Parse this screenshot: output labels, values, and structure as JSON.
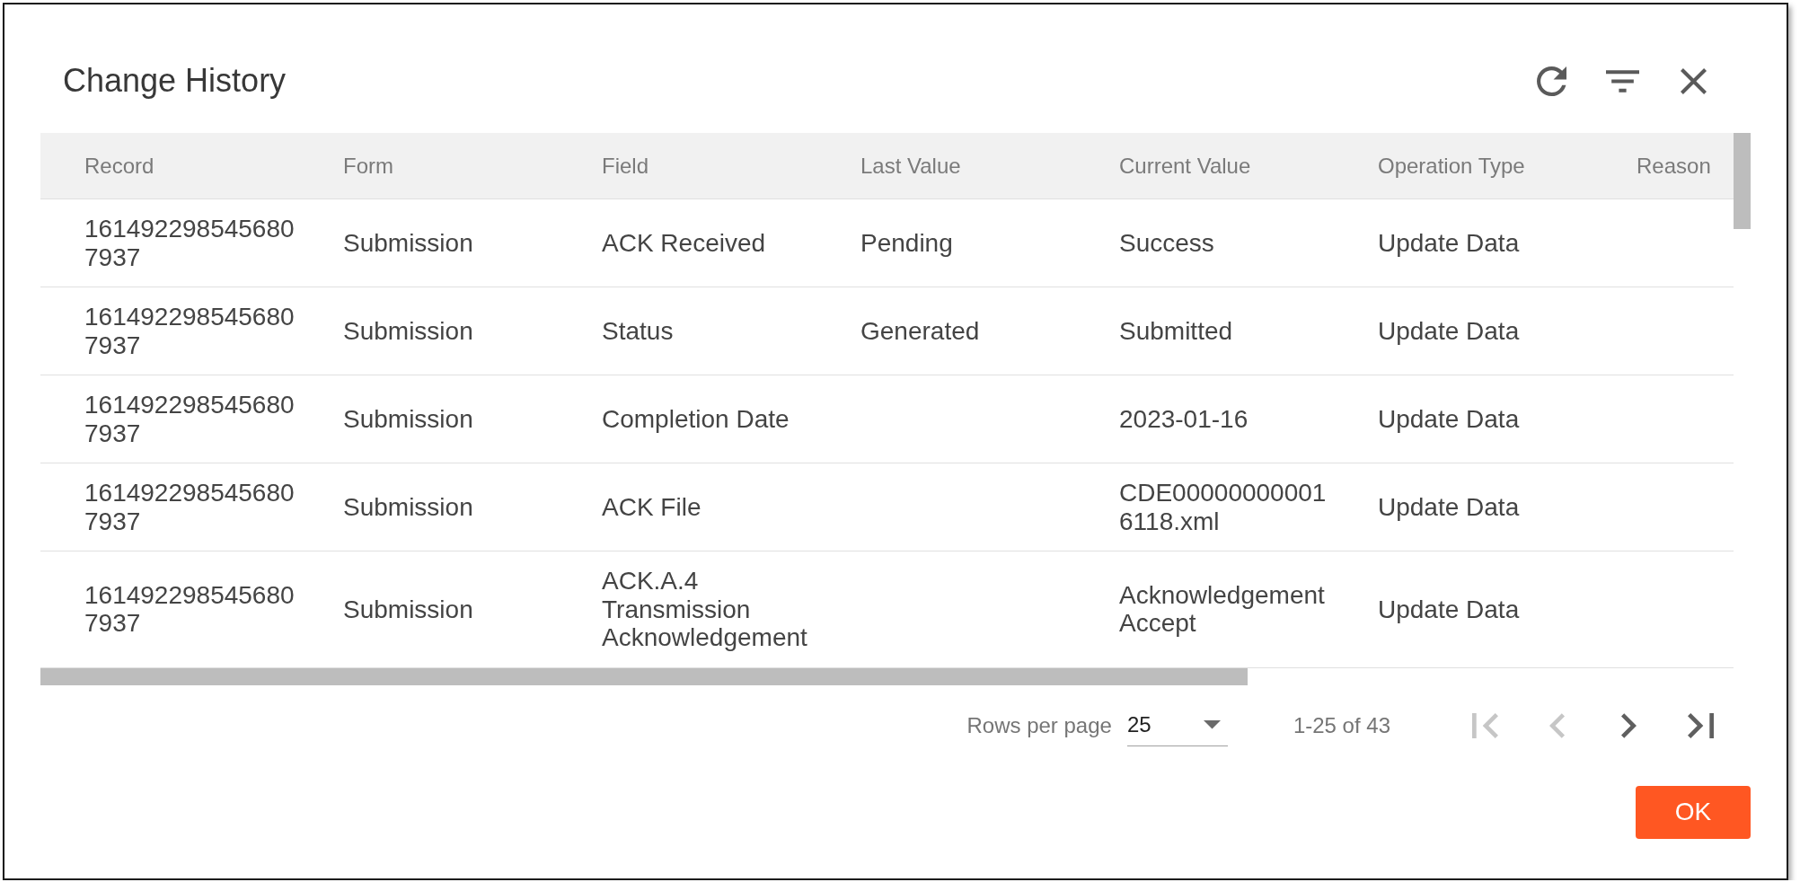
{
  "dialog": {
    "title": "Change History"
  },
  "table": {
    "columns": [
      "Record",
      "Form",
      "Field",
      "Last Value",
      "Current Value",
      "Operation Type",
      "Reason"
    ],
    "rows": [
      {
        "record": "1614922985456807937",
        "form": "Submission",
        "field": "ACK Received",
        "last_value": "Pending",
        "current_value": "Success",
        "operation_type": "Update Data"
      },
      {
        "record": "1614922985456807937",
        "form": "Submission",
        "field": "Status",
        "last_value": "Generated",
        "current_value": "Submitted",
        "operation_type": "Update Data"
      },
      {
        "record": "1614922985456807937",
        "form": "Submission",
        "field": "Completion Date",
        "current_value": "2023-01-16",
        "operation_type": "Update Data"
      },
      {
        "record": "1614922985456807937",
        "form": "Submission",
        "field": "ACK File",
        "current_value": "CDE000000000016118.xml",
        "operation_type": "Update Data"
      },
      {
        "record": "1614922985456807937",
        "form": "Submission",
        "field": "ACK.A.4 Transmission Acknowledgement",
        "current_value": "Acknowledgement Accept",
        "operation_type": "Update Data"
      }
    ]
  },
  "pagination": {
    "rows_per_page_label": "Rows per page",
    "rows_per_page": "25",
    "range": "1-25 of 43",
    "buttons": [
      {
        "kind": "first",
        "disabled": true
      },
      {
        "kind": "previous",
        "disabled": true
      },
      {
        "kind": "next",
        "disabled": false
      },
      {
        "kind": "last",
        "disabled": false
      }
    ]
  },
  "buttons": [
    "OK"
  ]
}
